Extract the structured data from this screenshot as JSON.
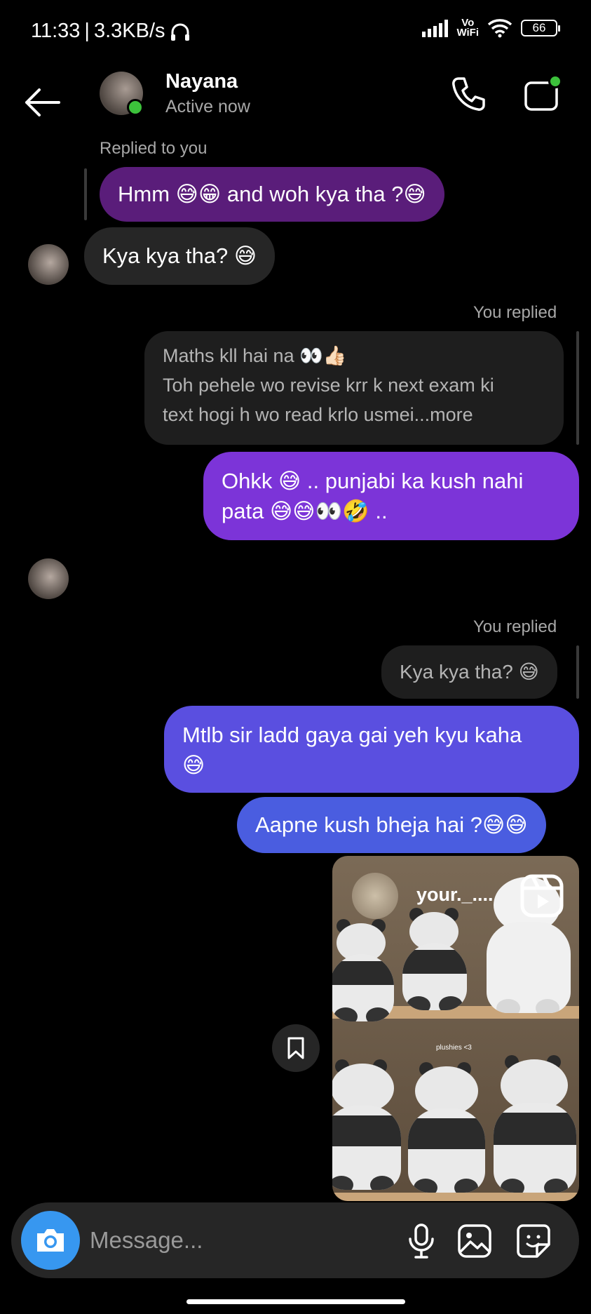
{
  "status_bar": {
    "time": "11:33",
    "speed": "3.3KB/s",
    "vowifi_top": "Vo",
    "vowifi_bottom": "WiFi",
    "battery": "66"
  },
  "header": {
    "contact_name": "Nayana",
    "contact_status": "Active now"
  },
  "messages": {
    "replied_label_1": "Replied to you",
    "out_1": "Hmm 😅😁 and woh kya tha ?😅",
    "in_1": "Kya kya tha? 😅",
    "you_replied_label_1": "You replied",
    "quoted_1_line1": "Maths kll hai na 👀👍🏻",
    "quoted_1_line2": "Toh pehele wo revise krr k next exam ki",
    "quoted_1_line3": "text hogi h wo read krlo usmei...more",
    "out_2_line1": "Ohkk 😅 .. punjabi ka kush nahi",
    "out_2_line2": "pata 😅😅👀🤣 ..",
    "you_replied_label_2": "You replied",
    "quoted_2": "Kya kya tha? 😅",
    "out_3_line1": "Mtlb sir ladd gaya gai yeh kyu kaha",
    "out_3_line2": "😅",
    "out_4": "Aapne kush bheja hai ?😅😅"
  },
  "reel": {
    "username": "your._....",
    "caption": "plushies <3"
  },
  "composer": {
    "placeholder": "Message..."
  },
  "colors": {
    "accent_blue": "#3797f0",
    "online_green": "#3cc13b",
    "bubble_purple_dark": "#5a1d7a",
    "bubble_purple": "#7c34d8",
    "bubble_indigo": "#5558e2",
    "bubble_blue": "#4a5de0"
  }
}
